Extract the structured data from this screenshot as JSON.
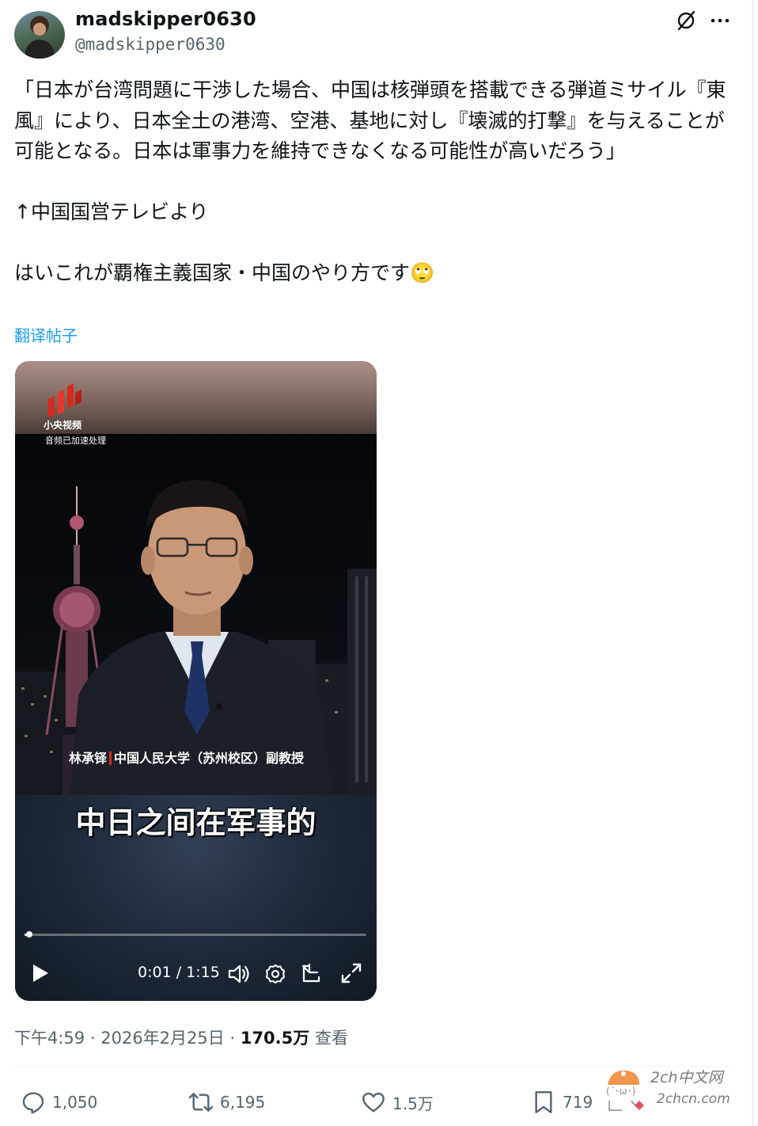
{
  "author": {
    "display_name": "madskipper0630",
    "handle": "@madskipper0630"
  },
  "tweet": {
    "text": "「日本が台湾問題に干渉した場合、中国は核弾頭を搭載できる弾道ミサイル『東風』により、日本全土の港湾、空港、基地に対し『壊滅的打撃』を与えることが可能となる。日本は軍事力を維持できなくなる可能性が高いだろう」\n\n↑中国国営テレビより\n\nはいこれが覇権主義国家・中国のやり方です🙄",
    "translate_label": "翻译帖子"
  },
  "video": {
    "logo_text": "小央视频",
    "audio_note": "音频已加速处理",
    "speaker_name": "林承铎",
    "speaker_title": "中国人民大学（苏州校区）副教授",
    "caption": "中日之间在军事的",
    "time": "0:01 / 1:15",
    "progress": 0.013
  },
  "meta": {
    "time": "下午4:59",
    "date": "2026年2月25日",
    "views": "170.5万",
    "views_label": "查看",
    "separator": "·"
  },
  "actions": {
    "replies": "1,050",
    "retweets": "6,195",
    "likes": "1.5万",
    "bookmarks": "719"
  },
  "watermark": {
    "line1": "2ch中文网",
    "line2": "2chcn.com"
  },
  "colors": {
    "accent": "#1d9bf0",
    "secondary_text": "#536471",
    "logo_red": "#d52b1e"
  }
}
